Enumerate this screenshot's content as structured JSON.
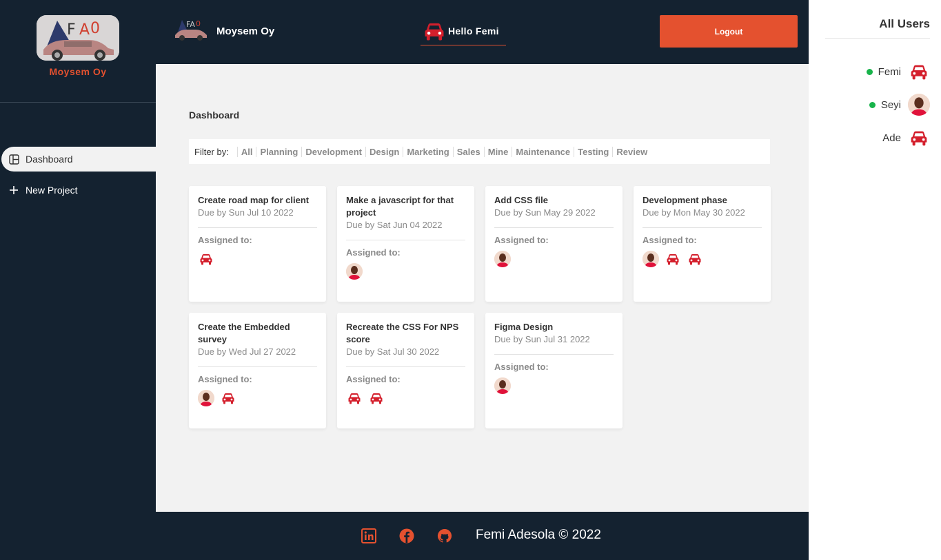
{
  "app": {
    "name": "Moysem Oy"
  },
  "sidebar": {
    "brand": "Moysem Oy",
    "items": [
      {
        "label": "Dashboard",
        "icon": "dashboard-icon",
        "active": true
      },
      {
        "label": "New Project",
        "icon": "plus-icon",
        "active": false
      }
    ]
  },
  "navbar": {
    "title": "Moysem Oy",
    "greeting": "Hello Femi",
    "logout_label": "Logout"
  },
  "main": {
    "title": "Dashboard",
    "filter": {
      "label": "Filter by:",
      "options": [
        "All",
        "Planning",
        "Development",
        "Design",
        "Marketing",
        "Sales",
        "Mine",
        "Maintenance",
        "Testing",
        "Review"
      ]
    },
    "assigned_label": "Assigned to:",
    "projects": [
      {
        "title": "Create road map for client",
        "due": "Due by Sun Jul 10 2022",
        "assignees": [
          "car"
        ]
      },
      {
        "title": "Make a javascript for that project",
        "due": "Due by Sat Jun 04 2022",
        "assignees": [
          "person"
        ]
      },
      {
        "title": "Add CSS file",
        "due": "Due by Sun May 29 2022",
        "assignees": [
          "person"
        ]
      },
      {
        "title": "Development phase",
        "due": "Due by Mon May 30 2022",
        "assignees": [
          "person",
          "car",
          "car"
        ]
      },
      {
        "title": "Create the Embedded survey",
        "due": "Due by Wed Jul 27 2022",
        "assignees": [
          "person",
          "car"
        ]
      },
      {
        "title": "Recreate the CSS For NPS score",
        "due": "Due by Sat Jul 30 2022",
        "assignees": [
          "car",
          "car"
        ]
      },
      {
        "title": "Figma Design",
        "due": "Due by Sun Jul 31 2022",
        "assignees": [
          "person"
        ]
      }
    ]
  },
  "footer": {
    "text": "Femi Adesola © 2022",
    "icons": [
      "linkedin-icon",
      "facebook-icon",
      "github-icon"
    ]
  },
  "users": {
    "title": "All Users",
    "list": [
      {
        "name": "Femi",
        "online": true,
        "avatar": "car"
      },
      {
        "name": "Seyi",
        "online": true,
        "avatar": "person"
      },
      {
        "name": "Ade",
        "online": false,
        "avatar": "car"
      }
    ]
  },
  "colors": {
    "accent": "#e4512f",
    "dark": "#142230",
    "online": "#17b34a",
    "car_red": "#d41f2c"
  }
}
